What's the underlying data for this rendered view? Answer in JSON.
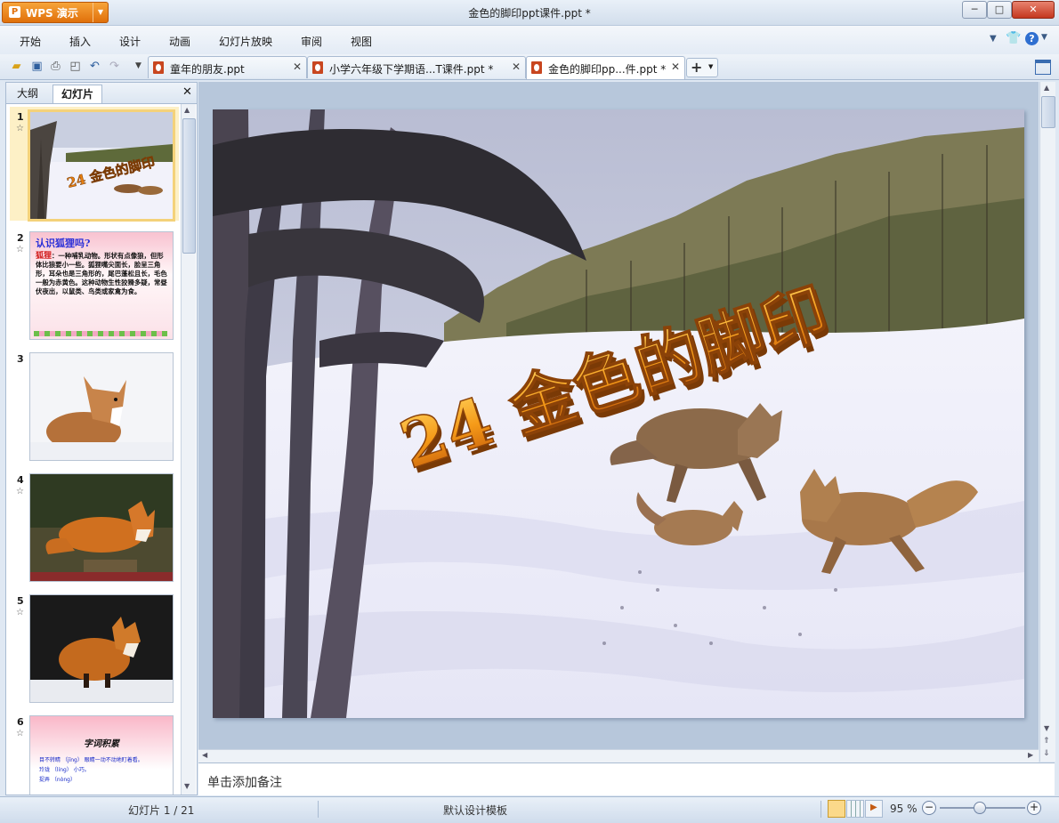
{
  "app": {
    "name": "WPS 演示",
    "window_title": "金色的脚印ppt课件.ppt *"
  },
  "window_controls": {
    "minimize": "─",
    "maximize": "□",
    "close": "✕"
  },
  "menu": [
    "开始",
    "插入",
    "设计",
    "动画",
    "幻灯片放映",
    "审阅",
    "视图"
  ],
  "doc_tabs": [
    {
      "label": "童年的朋友.ppt",
      "active": false
    },
    {
      "label": "小学六年级下学期语...T课件.ppt *",
      "active": false
    },
    {
      "label": "金色的脚印pp...件.ppt *",
      "active": true
    }
  ],
  "panel_tabs": [
    {
      "label": "大纲",
      "active": false
    },
    {
      "label": "幻灯片",
      "active": true
    }
  ],
  "slides": [
    {
      "num": "1",
      "star": "☆",
      "title": "24 金色的脚印"
    },
    {
      "num": "2",
      "star": "☆",
      "title": "认识狐狸吗?",
      "body_title": "狐狸",
      "body": "：一种哺乳动物。形状有点像狼，但形体比狼要小一些。狐狸嘴尖面长，脸呈三角形，耳朵也是三角形的，尾巴蓬松且长，毛色一般为赤黄色。这种动物生性狡猾多疑，常昼伏夜出，以鼠类、鸟类或家禽为食。"
    },
    {
      "num": "3",
      "star": "",
      "title": ""
    },
    {
      "num": "4",
      "star": "☆",
      "title": ""
    },
    {
      "num": "5",
      "star": "☆",
      "title": ""
    },
    {
      "num": "6",
      "star": "☆",
      "title": "字词积累",
      "lines": [
        "目不转睛 （jīng）  眼睛一动不动地盯着看。",
        "玲珑 （líng） 小巧。",
        "捉弄 （nòng）"
      ]
    }
  ],
  "main_slide": {
    "title": "24 金色的脚印"
  },
  "notes_placeholder": "单击添加备注",
  "status": {
    "slide_info": "幻灯片 1 / 21",
    "template": "默认设计模板",
    "zoom": "95 %"
  },
  "colors": {
    "accent_orange": "#e8820e",
    "title_orange": "#f08a12",
    "frame_blue": "#b7c7db"
  }
}
